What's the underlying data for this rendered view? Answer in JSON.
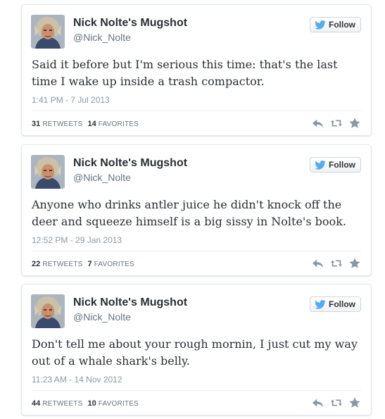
{
  "follow_label": "Follow",
  "colors": {
    "twitter_blue": "#55acee",
    "icon_gray": "#8899a6",
    "name": "#292f33",
    "secondary_text": "#66757f"
  },
  "icons": {
    "follow": "twitter-bird-icon",
    "reply": "reply-icon",
    "retweet": "retweet-icon",
    "favorite": "star-icon"
  },
  "tweets": [
    {
      "display_name": "Nick Nolte's Mugshot",
      "screen_name": "@Nick_Nolte",
      "text": "Said it before but I'm serious this time: that's the last time I wake up inside a trash compactor.",
      "timestamp": "1:41 PM - 7 Jul 2013",
      "retweets": "31",
      "retweets_label": "Retweets",
      "favorites": "14",
      "favorites_label": "Favorites"
    },
    {
      "display_name": "Nick Nolte's Mugshot",
      "screen_name": "@Nick_Nolte",
      "text": "Anyone who drinks antler juice he didn't knock off the deer and squeeze himself is a big sissy in Nolte's book.",
      "timestamp": "12:52 PM - 29 Jan 2013",
      "retweets": "22",
      "retweets_label": "Retweets",
      "favorites": "7",
      "favorites_label": "Favorites"
    },
    {
      "display_name": "Nick Nolte's Mugshot",
      "screen_name": "@Nick_Nolte",
      "text": "Don't tell me about your rough mornin, I just cut my way out of a whale shark's belly.",
      "timestamp": "11:23 AM - 14 Nov 2012",
      "retweets": "44",
      "retweets_label": "Retweets",
      "favorites": "10",
      "favorites_label": "Favorites"
    }
  ]
}
